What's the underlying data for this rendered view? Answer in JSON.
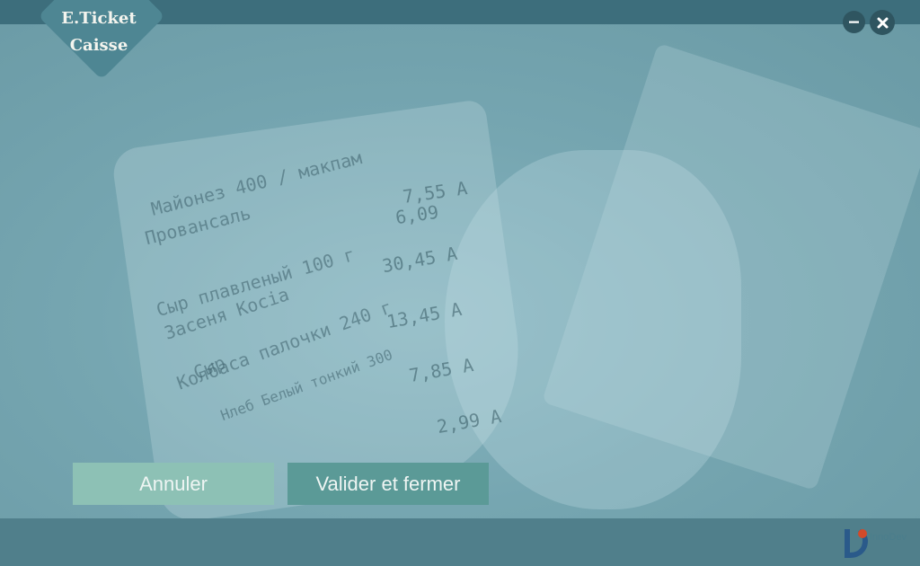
{
  "window": {
    "app_line1": "E.Ticket",
    "app_line2": "Caisse"
  },
  "receipt": {
    "lines": [
      "Майонез 400 / макпам",
      "Провансаль",
      "Сыр плавленый 100 г",
      "Засеня Косіа",
      "Колбаса палочки 240 г",
      "Сыр",
      "Hлеб Белый тонкий 300"
    ],
    "amounts": [
      "7,55 A",
      "6,09",
      "30,45 A",
      "13,45 A",
      "7,85 A",
      "2,99 A"
    ]
  },
  "actions": {
    "cancel_label": "Annuler",
    "confirm_label": "Valider et fermer"
  },
  "footer": {
    "brand_name": "InnoDev"
  },
  "colors": {
    "topbar": "#3d6e7c",
    "bottombar": "#507f8b",
    "cancel_button": "#8dc1b5",
    "confirm_button": "#5b9a97",
    "window_control": "#2f5560"
  },
  "icons": {
    "minimize": "minimize-icon",
    "close": "close-icon",
    "brand": "innodev-logo-icon"
  }
}
